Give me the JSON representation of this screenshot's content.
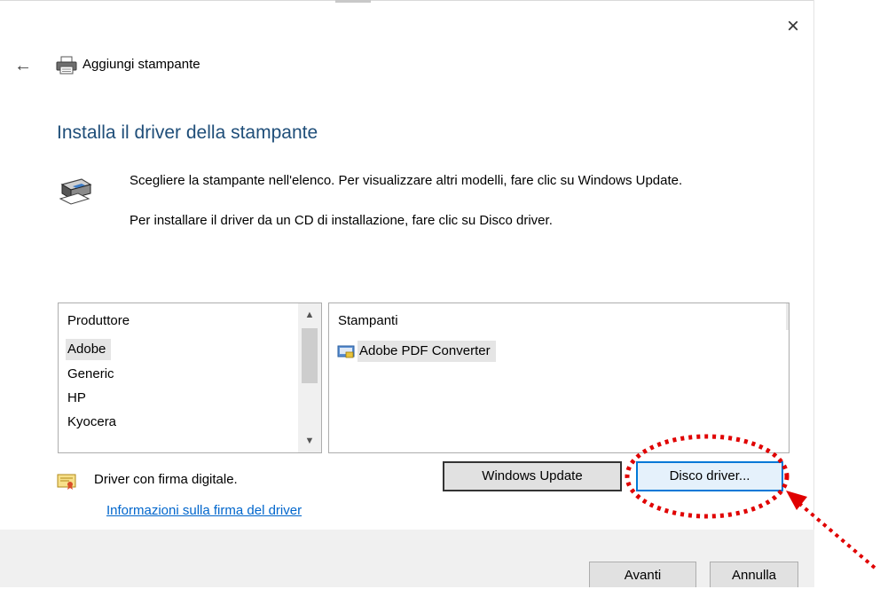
{
  "window": {
    "title": "Aggiungi stampante",
    "close_glyph": "×",
    "back_glyph": "←"
  },
  "page": {
    "heading": "Installa il driver della stampante",
    "instructions": [
      "Scegliere la stampante nell'elenco. Per visualizzare altri modelli, fare clic su Windows Update.",
      "Per installare il driver da un CD di installazione, fare clic su Disco driver."
    ]
  },
  "manufacturers": {
    "header": "Produttore",
    "items": [
      "Adobe",
      "Generic",
      "HP",
      "Kyocera"
    ],
    "selected": "Adobe"
  },
  "printers": {
    "header": "Stampanti",
    "items": [
      "Adobe PDF Converter"
    ]
  },
  "signature": {
    "text": "Driver con firma digitale.",
    "link": "Informazioni sulla firma del driver"
  },
  "buttons": {
    "windows_update": "Windows Update",
    "disk_driver": "Disco driver...",
    "next": "Avanti",
    "cancel": "Annulla"
  },
  "icons": {
    "back": "back-arrow-icon",
    "close": "close-icon",
    "title": "printer-icon",
    "instructions": "printer-icon",
    "printer_item": "printer-icon",
    "signature": "certificate-icon",
    "scroll_up": "chevron-up-icon",
    "scroll_down": "chevron-down-icon"
  },
  "colors": {
    "heading": "#1f4e79",
    "link": "#0066cc",
    "focus_border": "#0078d7",
    "annotation": "#e00000",
    "footer": "#f0f0f0"
  }
}
